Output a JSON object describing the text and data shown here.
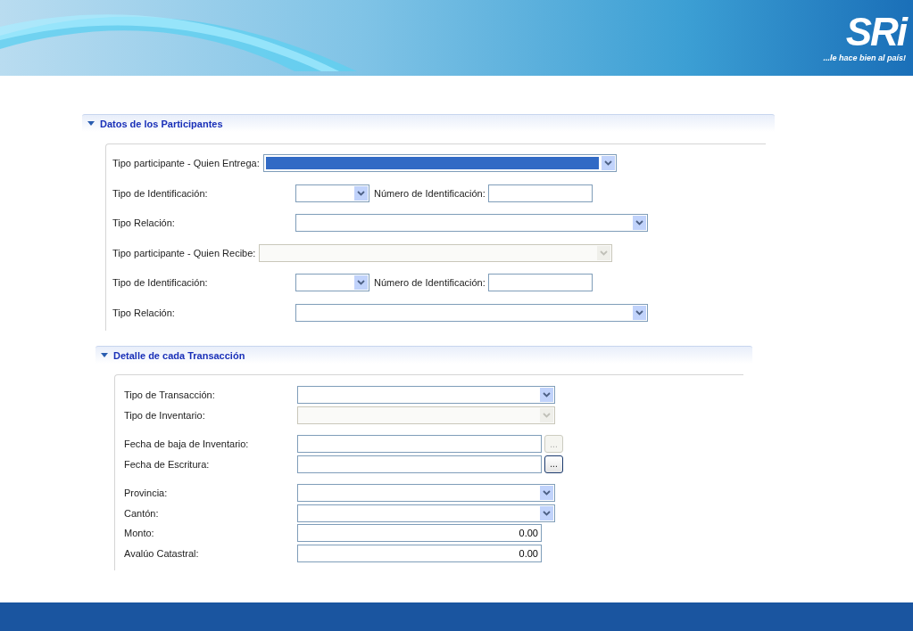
{
  "header": {
    "logo": "SRi",
    "slogan": "...le hace bien al país!"
  },
  "participants": {
    "title": "Datos de los Participantes",
    "expanded": true,
    "rows": [
      {
        "kind": "inline-select",
        "label": "Tipo participante - Quien Entrega:",
        "highlighted": true,
        "disabled": false
      },
      {
        "kind": "id-pair",
        "label": "Tipo de Identificación:",
        "second_label": "Número de Identificación:"
      },
      {
        "kind": "select",
        "label": "Tipo Relación:",
        "disabled": false
      },
      {
        "kind": "inline-select",
        "label": "Tipo participante - Quien Recibe:",
        "highlighted": false,
        "disabled": true
      },
      {
        "kind": "id-pair",
        "label": "Tipo de Identificación:",
        "second_label": "Número de Identificación:"
      },
      {
        "kind": "select",
        "label": "Tipo Relación:",
        "disabled": false
      }
    ]
  },
  "transaction": {
    "title": "Detalle de cada Transacción",
    "expanded": true,
    "groups": [
      [
        {
          "kind": "select",
          "label": "Tipo de Transacción:",
          "disabled": false
        },
        {
          "kind": "select",
          "label": "Tipo de Inventario:",
          "disabled": true
        }
      ],
      [
        {
          "kind": "date",
          "label": "Fecha de baja de Inventario:",
          "button_label": "...",
          "disabled": true
        },
        {
          "kind": "date",
          "label": "Fecha de Escritura:",
          "button_label": "...",
          "disabled": false
        }
      ],
      [
        {
          "kind": "select",
          "label": "Provincia:",
          "disabled": false
        },
        {
          "kind": "select",
          "label": "Cantón:",
          "disabled": false
        },
        {
          "kind": "amount",
          "label": "Monto:",
          "value": "0.00"
        },
        {
          "kind": "amount",
          "label": "Avalúo Catastral:",
          "value": "0.00"
        }
      ]
    ]
  }
}
